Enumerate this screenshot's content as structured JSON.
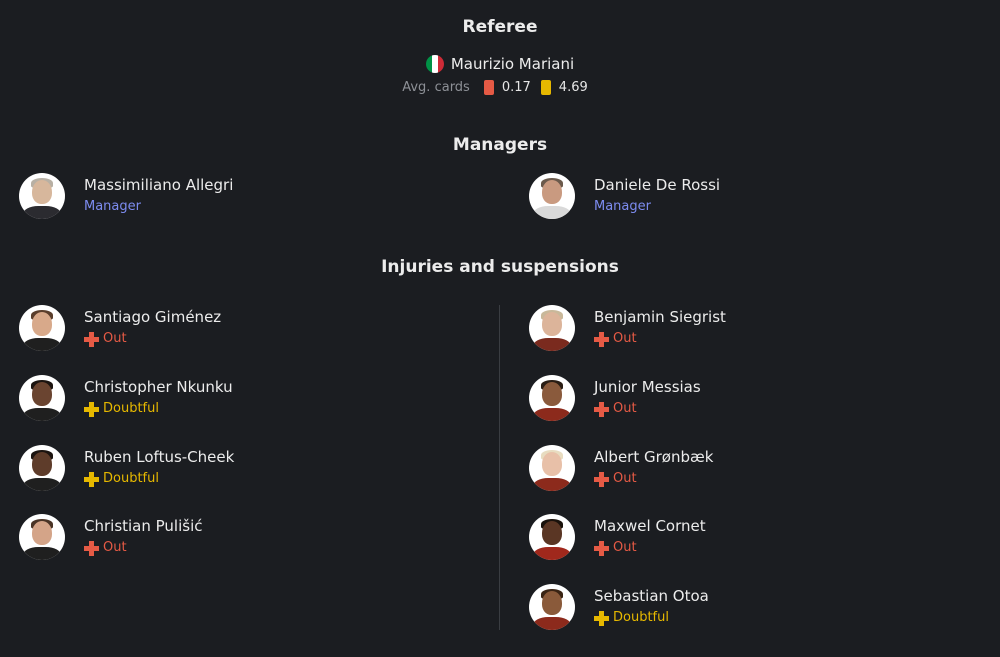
{
  "referee": {
    "title": "Referee",
    "name": "Maurizio Mariani",
    "flag_colors": [
      "#009246",
      "#ffffff",
      "#ce2b37"
    ],
    "avg_cards_label": "Avg. cards",
    "red_avg": "0.17",
    "yellow_avg": "4.69"
  },
  "managers": {
    "title": "Managers",
    "home": {
      "name": "Massimiliano Allegri",
      "role": "Manager"
    },
    "away": {
      "name": "Daniele De Rossi",
      "role": "Manager"
    }
  },
  "injuries": {
    "title": "Injuries and suspensions",
    "home": [
      {
        "name": "Santiago Giménez",
        "status": "Out"
      },
      {
        "name": "Christopher Nkunku",
        "status": "Doubtful"
      },
      {
        "name": "Ruben Loftus-Cheek",
        "status": "Doubtful"
      },
      {
        "name": "Christian Pulišić",
        "status": "Out"
      }
    ],
    "away": [
      {
        "name": "Benjamin Siegrist",
        "status": "Out"
      },
      {
        "name": "Junior Messias",
        "status": "Out"
      },
      {
        "name": "Albert Grønbæk",
        "status": "Out"
      },
      {
        "name": "Maxwel Cornet",
        "status": "Out"
      },
      {
        "name": "Sebastian Otoa",
        "status": "Doubtful"
      }
    ]
  },
  "colors": {
    "background": "#1b1d21",
    "out": "#e55a45",
    "doubtful": "#e6b800",
    "role": "#7d8cf0",
    "muted": "#8d9096"
  }
}
